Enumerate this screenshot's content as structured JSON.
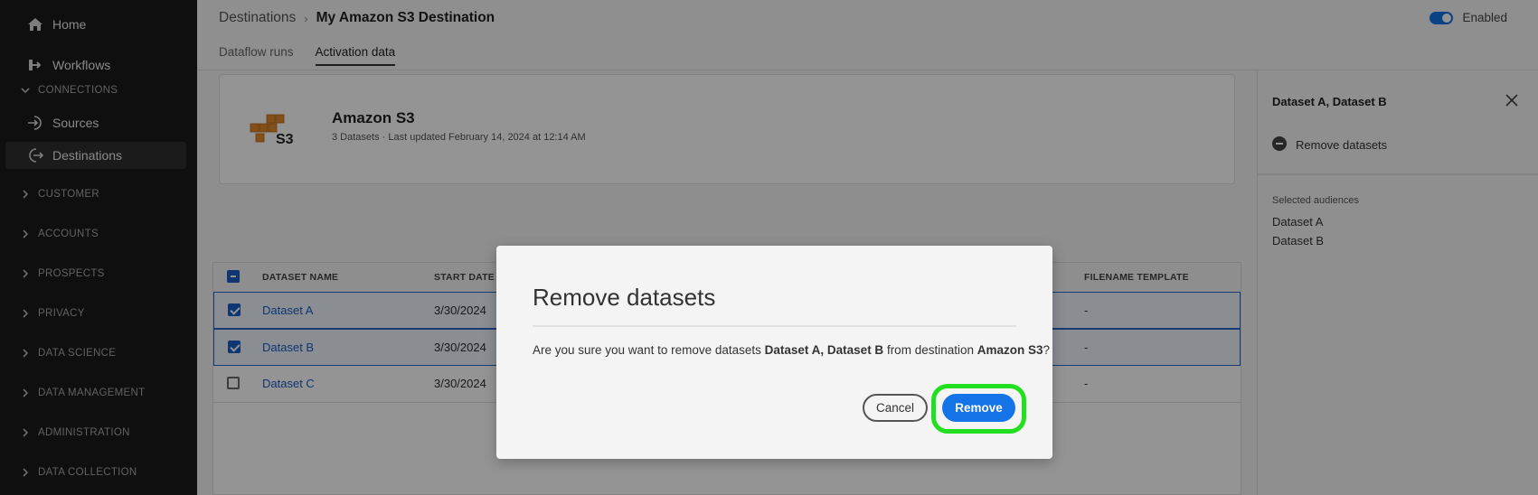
{
  "sidebar": {
    "top_items": [
      {
        "label": "Home",
        "icon": "home-icon"
      },
      {
        "label": "Workflows",
        "icon": "workflow-icon"
      }
    ],
    "connections_label": "CONNECTIONS",
    "connections_items": [
      {
        "label": "Sources",
        "icon": "sign-in-icon"
      },
      {
        "label": "Destinations",
        "icon": "sign-out-icon",
        "active": true
      }
    ],
    "sections": [
      "CUSTOMER",
      "ACCOUNTS",
      "PROSPECTS",
      "PRIVACY",
      "DATA SCIENCE",
      "DATA MANAGEMENT",
      "ADMINISTRATION",
      "DATA COLLECTION"
    ]
  },
  "header": {
    "breadcrumb_parent": "Destinations",
    "breadcrumb_current": "My Amazon S3 Destination",
    "tabs": [
      "Dataflow runs",
      "Activation data"
    ],
    "active_tab": "Activation data",
    "toggle_label": "Enabled"
  },
  "card": {
    "title": "Amazon S3",
    "subtitle": "3 Datasets · Last updated February 14, 2024 at 12:14 AM",
    "logo_text": "S3"
  },
  "table": {
    "headers": {
      "name": "DATASET NAME",
      "start": "START DATE",
      "filename": "FILENAME TEMPLATE"
    },
    "rows": [
      {
        "name": "Dataset A",
        "start": "3/30/2024",
        "filename": "-",
        "checked": true
      },
      {
        "name": "Dataset B",
        "start": "3/30/2024",
        "filename": "-",
        "checked": true
      },
      {
        "name": "Dataset C",
        "start": "3/30/2024",
        "filename": "-",
        "checked": false
      }
    ]
  },
  "rail": {
    "title": "Dataset A, Dataset B",
    "action": "Remove datasets",
    "selected_label": "Selected audiences",
    "selected_items": [
      "Dataset A",
      "Dataset B"
    ]
  },
  "modal": {
    "title": "Remove datasets",
    "body_prefix": "Are you sure you want to remove datasets ",
    "body_datasets": "Dataset A, Dataset B",
    "body_middle": " from destination ",
    "body_destination": "Amazon S3",
    "body_suffix": "?",
    "cancel_label": "Cancel",
    "remove_label": "Remove"
  },
  "colors": {
    "accent": "#1473e6",
    "highlight": "#22e01f",
    "sidebar_bg": "#1a1a1a"
  }
}
